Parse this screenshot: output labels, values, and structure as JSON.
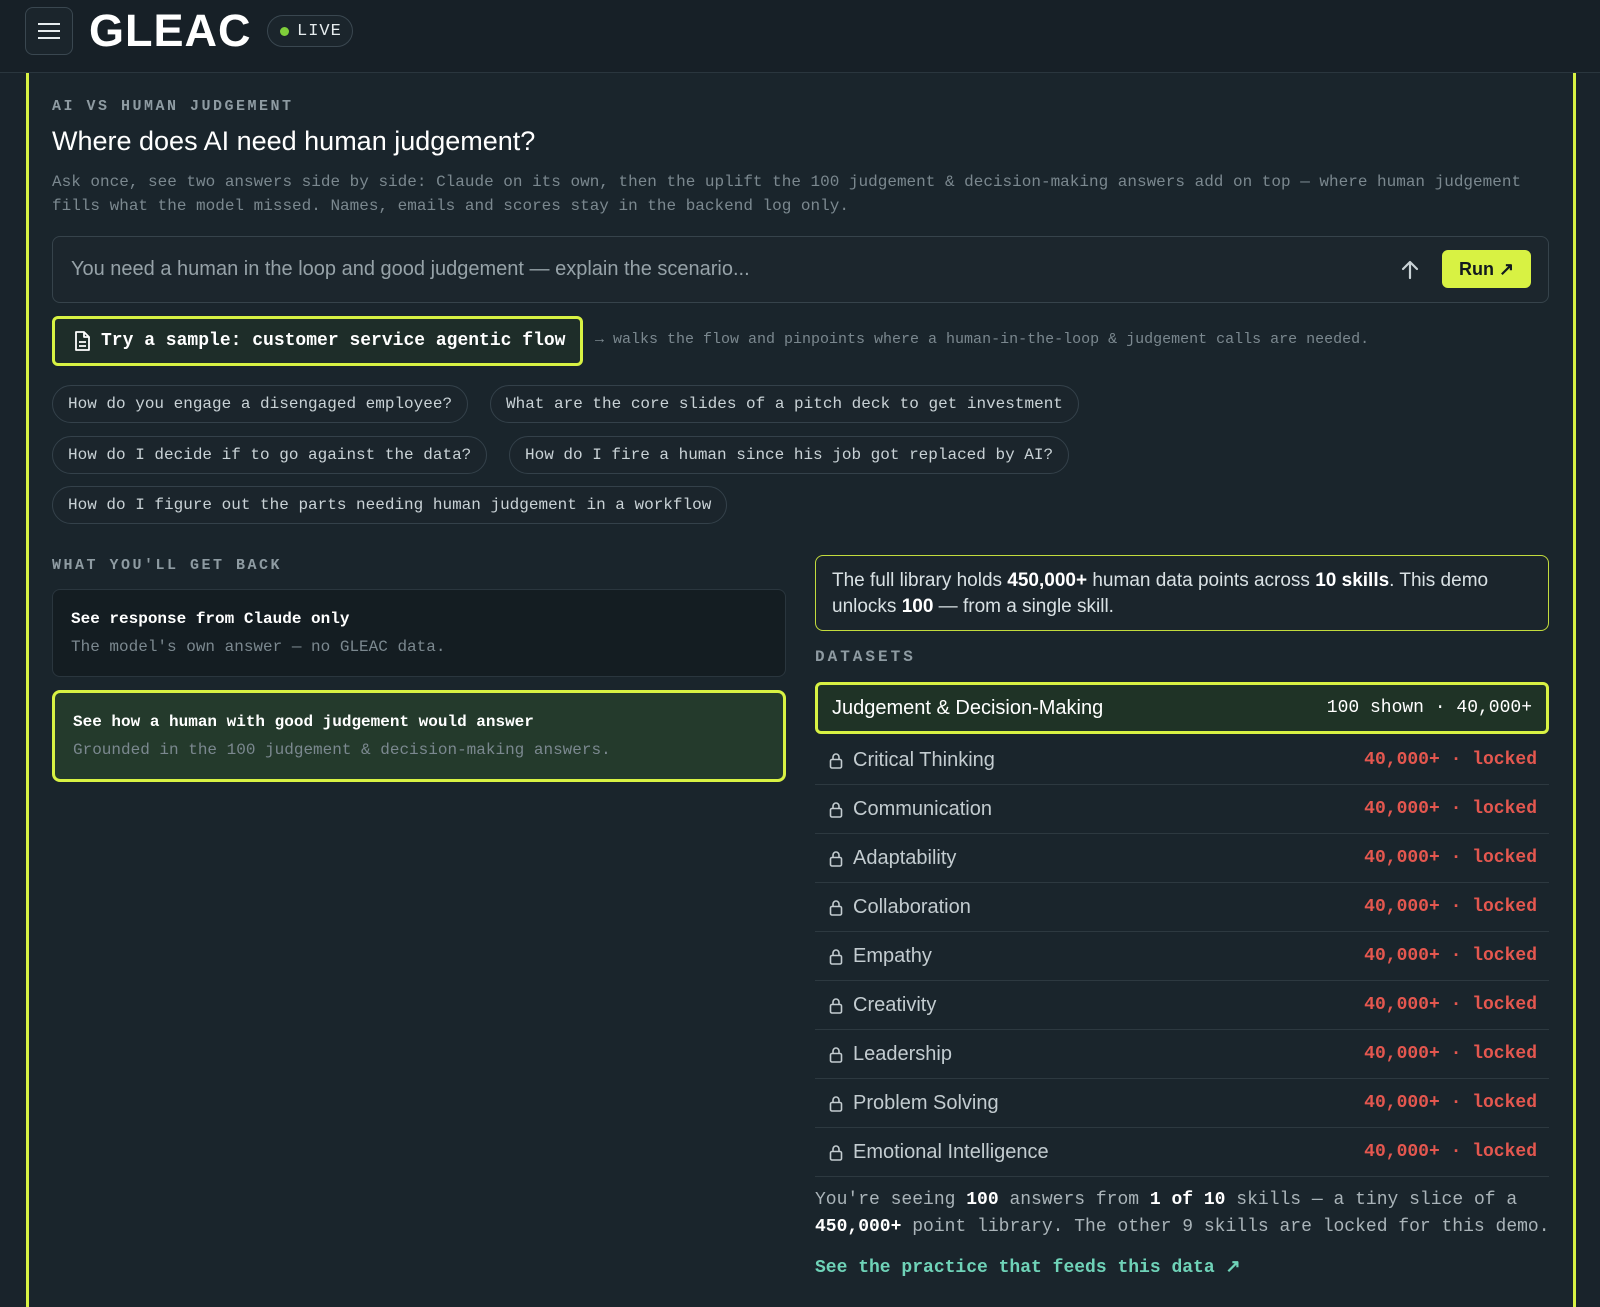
{
  "header": {
    "menu_icon": "hamburger-menu-icon",
    "logo": "GLEAC",
    "live_label": "LIVE",
    "live_color": "#7fce3a"
  },
  "accent_color": "#d8f243",
  "main": {
    "eyebrow": "AI VS HUMAN JUDGEMENT",
    "title": "Where does AI need human judgement?",
    "description": "Ask once, see two answers side by side: Claude on its own, then the uplift the 100 judgement & decision-making answers add on top — where human judgement fills what the model missed. Names, emails and scores stay in the backend log only.",
    "prompt": {
      "placeholder": "You need a human in the loop and good judgement — explain the scenario...",
      "value": "",
      "run_label": "Run ↗"
    },
    "sample": {
      "label": "Try a sample: customer service agentic flow",
      "note": "→ walks the flow and pinpoints where a human-in-the-loop & judgement calls are needed."
    },
    "suggestions": [
      "How do you engage a disengaged employee?",
      "What are the core slides of a pitch deck to get investment",
      "How do I decide if to go against the data?",
      "How do I fire a human since his job got replaced by AI?",
      "How do I figure out the parts needing human judgement in a workflow"
    ]
  },
  "response_options": {
    "label": "WHAT YOU'LL GET BACK",
    "options": [
      {
        "title": "See response from Claude only",
        "subtitle": "The model's own answer — no GLEAC data."
      },
      {
        "title": "See how a human with good judgement would answer",
        "subtitle": "Grounded in the 100 judgement & decision-making answers."
      }
    ]
  },
  "library": {
    "p1": "The full library holds ",
    "points": "450,000+",
    "p2": " human data points across ",
    "skills": "10 skills",
    "p3": ". This demo unlocks ",
    "unlocked": "100",
    "p4": " — from a single skill."
  },
  "datasets": {
    "label": "DATASETS",
    "active": {
      "name": "Judgement & Decision-Making",
      "count": "100 shown · 40,000+"
    },
    "locked_status": "40,000+ · locked",
    "locked": [
      "Critical Thinking",
      "Communication",
      "Adaptability",
      "Collaboration",
      "Empathy",
      "Creativity",
      "Leadership",
      "Problem Solving",
      "Emotional Intelligence"
    ],
    "locked_color": "#e4574f"
  },
  "footer": {
    "t1": "You're seeing ",
    "answers": "100",
    "t2": " answers from ",
    "of_skills": "1 of 10",
    "t3": " skills — a tiny slice of a ",
    "library_size": "450,000+",
    "t4": " point library. The other 9 skills are locked for this demo.",
    "link": "See the practice that feeds this data ↗"
  }
}
